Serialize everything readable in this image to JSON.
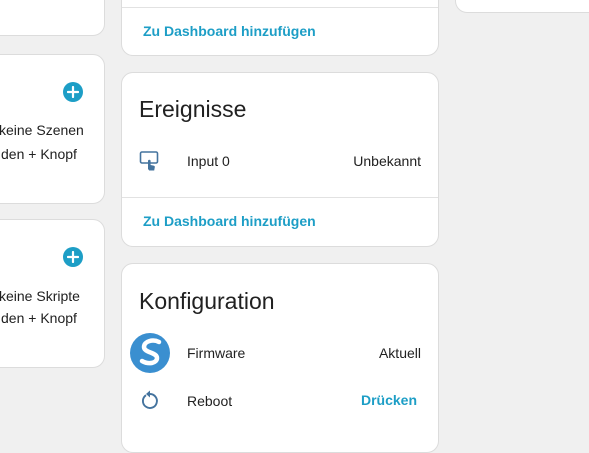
{
  "scenes_card": {
    "text_line1": "keine Szenen",
    "text_line2": "den + Knopf"
  },
  "scripts_card": {
    "text_line1": "keine Skripte",
    "text_line2": "den + Knopf"
  },
  "top_card": {
    "link": "Zu Dashboard hinzufügen"
  },
  "events_card": {
    "title": "Ereignisse",
    "row": {
      "label": "Input 0",
      "value": "Unbekannt"
    },
    "link": "Zu Dashboard hinzufügen"
  },
  "config_card": {
    "title": "Konfiguration",
    "firmware": {
      "label": "Firmware",
      "value": "Aktuell"
    },
    "reboot": {
      "label": "Reboot",
      "action": "Drücken"
    }
  },
  "colors": {
    "accent": "#1d9ec6",
    "logo": "#3a8fd0"
  },
  "icons": {
    "plus": "plus-circle-icon",
    "event": "gesture-tap-button-icon",
    "firmware": "shelly-logo-icon",
    "reboot": "restart-icon"
  }
}
